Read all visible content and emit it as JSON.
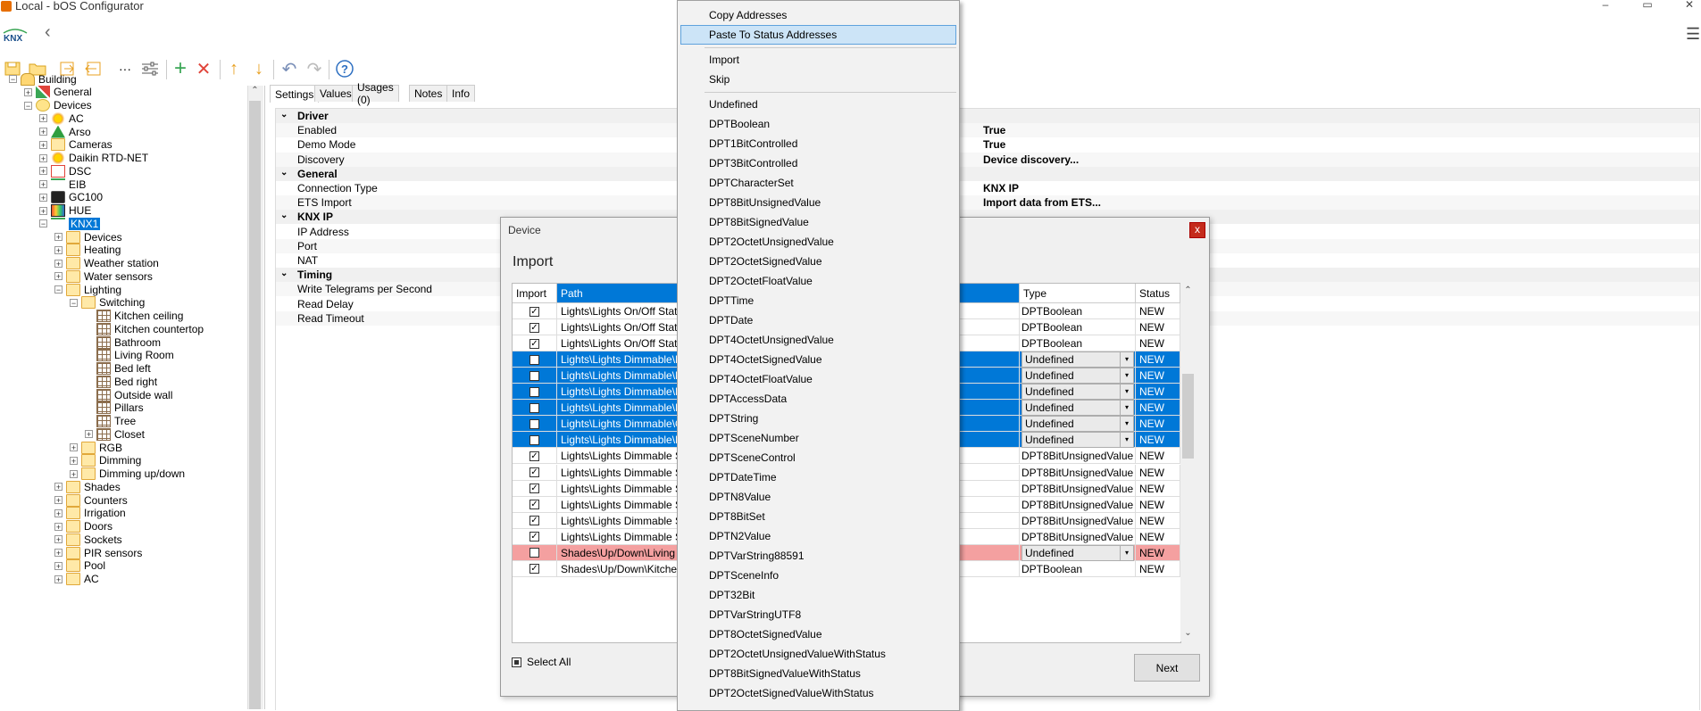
{
  "window": {
    "title": "Local - bOS Configurator",
    "controls": [
      "–",
      "▭",
      "✕"
    ]
  },
  "toolbar": {
    "icons": [
      "save-icon",
      "open-folder-icon",
      "export-icon",
      "import-icon",
      "more-icon",
      "settings-sliders-icon",
      "add-icon",
      "delete-icon",
      "move-up-icon",
      "move-down-icon",
      "undo-icon",
      "redo-icon",
      "help-icon"
    ],
    "more_label": "···"
  },
  "tree": {
    "items": [
      {
        "label": "Building",
        "depth": 0,
        "icon": "building-icon",
        "expander": "−"
      },
      {
        "label": "General",
        "depth": 1,
        "icon": "tools-icon",
        "expander": "+"
      },
      {
        "label": "Devices",
        "depth": 1,
        "icon": "bulb-icon",
        "expander": "−"
      },
      {
        "label": "AC",
        "depth": 2,
        "icon": "sun-icon",
        "expander": "+"
      },
      {
        "label": "Arso",
        "depth": 2,
        "icon": "tree-icon",
        "expander": "+"
      },
      {
        "label": "Cameras",
        "depth": 2,
        "icon": "folder-icon",
        "expander": "+"
      },
      {
        "label": "Daikin RTD-NET",
        "depth": 2,
        "icon": "sun-icon",
        "expander": "+"
      },
      {
        "label": "DSC",
        "depth": 2,
        "icon": "dsc-icon",
        "expander": "+"
      },
      {
        "label": "EIB",
        "depth": 2,
        "icon": "knx-icon",
        "expander": "+"
      },
      {
        "label": "GC100",
        "depth": 2,
        "icon": "gc-icon",
        "expander": "+"
      },
      {
        "label": "HUE",
        "depth": 2,
        "icon": "hue-icon",
        "expander": "+"
      },
      {
        "label": "KNX1",
        "depth": 2,
        "icon": "knx-icon",
        "expander": "−",
        "selected": true
      },
      {
        "label": "Devices",
        "depth": 3,
        "icon": "folder-icon",
        "expander": "+"
      },
      {
        "label": "Heating",
        "depth": 3,
        "icon": "folder-icon",
        "expander": "+"
      },
      {
        "label": "Weather station",
        "depth": 3,
        "icon": "folder-icon",
        "expander": "+"
      },
      {
        "label": "Water sensors",
        "depth": 3,
        "icon": "folder-icon",
        "expander": "+"
      },
      {
        "label": "Lighting",
        "depth": 3,
        "icon": "folder-icon",
        "expander": "−"
      },
      {
        "label": "Switching",
        "depth": 4,
        "icon": "folder-icon",
        "expander": "−"
      },
      {
        "label": "Kitchen ceiling",
        "depth": 5,
        "icon": "grid-icon",
        "expander": ""
      },
      {
        "label": "Kitchen countertop",
        "depth": 5,
        "icon": "grid-icon",
        "expander": ""
      },
      {
        "label": "Bathroom",
        "depth": 5,
        "icon": "grid-icon",
        "expander": ""
      },
      {
        "label": "Living Room",
        "depth": 5,
        "icon": "grid-icon",
        "expander": ""
      },
      {
        "label": "Bed left",
        "depth": 5,
        "icon": "grid-icon",
        "expander": ""
      },
      {
        "label": "Bed right",
        "depth": 5,
        "icon": "grid-icon",
        "expander": ""
      },
      {
        "label": "Outside wall",
        "depth": 5,
        "icon": "grid-icon",
        "expander": ""
      },
      {
        "label": "Pillars",
        "depth": 5,
        "icon": "grid-icon",
        "expander": ""
      },
      {
        "label": "Tree",
        "depth": 5,
        "icon": "grid-icon",
        "expander": ""
      },
      {
        "label": "Closet",
        "depth": 5,
        "icon": "grid-icon",
        "expander": "+"
      },
      {
        "label": "RGB",
        "depth": 4,
        "icon": "folder-icon",
        "expander": "+"
      },
      {
        "label": "Dimming",
        "depth": 4,
        "icon": "folder-icon",
        "expander": "+"
      },
      {
        "label": "Dimming up/down",
        "depth": 4,
        "icon": "folder-icon",
        "expander": "+"
      },
      {
        "label": "Shades",
        "depth": 3,
        "icon": "folder-icon",
        "expander": "+"
      },
      {
        "label": "Counters",
        "depth": 3,
        "icon": "folder-icon",
        "expander": "+"
      },
      {
        "label": "Irrigation",
        "depth": 3,
        "icon": "folder-icon",
        "expander": "+"
      },
      {
        "label": "Doors",
        "depth": 3,
        "icon": "folder-icon",
        "expander": "+"
      },
      {
        "label": "Sockets",
        "depth": 3,
        "icon": "folder-icon",
        "expander": "+"
      },
      {
        "label": "PIR sensors",
        "depth": 3,
        "icon": "folder-icon",
        "expander": "+"
      },
      {
        "label": "Pool",
        "depth": 3,
        "icon": "folder-icon",
        "expander": "+"
      },
      {
        "label": "AC",
        "depth": 3,
        "icon": "folder-icon",
        "expander": "+"
      }
    ]
  },
  "props_tabs": [
    "Settings",
    "Values",
    "Usages (0)",
    "Notes",
    "Info"
  ],
  "props": {
    "rows": [
      {
        "kind": "cat",
        "name": "Driver"
      },
      {
        "kind": "prop",
        "name": "Enabled",
        "value": "True"
      },
      {
        "kind": "prop",
        "name": "Demo Mode",
        "value": "True"
      },
      {
        "kind": "prop",
        "name": "Discovery",
        "value": "Device discovery..."
      },
      {
        "kind": "cat",
        "name": "General"
      },
      {
        "kind": "prop",
        "name": "Connection Type",
        "value": "KNX IP"
      },
      {
        "kind": "prop",
        "name": "ETS Import",
        "value": "Import data from ETS..."
      },
      {
        "kind": "cat",
        "name": "KNX IP"
      },
      {
        "kind": "prop",
        "name": "IP Address",
        "value": ""
      },
      {
        "kind": "prop",
        "name": "Port",
        "value": ""
      },
      {
        "kind": "prop",
        "name": "NAT",
        "value": ""
      },
      {
        "kind": "cat",
        "name": "Timing"
      },
      {
        "kind": "prop",
        "name": "Write Telegrams per Second",
        "value": ""
      },
      {
        "kind": "prop",
        "name": "Read Delay",
        "value": ""
      },
      {
        "kind": "prop",
        "name": "Read Timeout",
        "value": ""
      }
    ]
  },
  "dialog": {
    "title": "Device",
    "close": "x",
    "heading": "Import",
    "columns": [
      "Import",
      "Path",
      "Type",
      "Status"
    ],
    "rows": [
      {
        "checked": true,
        "path": "Lights\\Lights On/Off Status\\",
        "type": "DPTBoolean",
        "status": "NEW",
        "style": "normal",
        "combo": false
      },
      {
        "checked": true,
        "path": "Lights\\Lights On/Off Status\\",
        "type": "DPTBoolean",
        "status": "NEW",
        "style": "normal",
        "combo": false
      },
      {
        "checked": true,
        "path": "Lights\\Lights On/Off Status\\",
        "type": "DPTBoolean",
        "status": "NEW",
        "style": "normal",
        "combo": false
      },
      {
        "checked": false,
        "path": "Lights\\Lights Dimmable\\Bed",
        "type": "Undefined",
        "status": "NEW",
        "style": "sel",
        "combo": true
      },
      {
        "checked": false,
        "path": "Lights\\Lights Dimmable\\Livi",
        "type": "Undefined",
        "status": "NEW",
        "style": "sel",
        "combo": true
      },
      {
        "checked": false,
        "path": "Lights\\Lights Dimmable\\Kitc",
        "type": "Undefined",
        "status": "NEW",
        "style": "sel",
        "combo": true
      },
      {
        "checked": false,
        "path": "Lights\\Lights Dimmable\\Dec",
        "type": "Undefined",
        "status": "NEW",
        "style": "sel",
        "combo": true
      },
      {
        "checked": false,
        "path": "Lights\\Lights Dimmable\\Out",
        "type": "Undefined",
        "status": "NEW",
        "style": "sel",
        "combo": true
      },
      {
        "checked": false,
        "path": "Lights\\Lights Dimmable\\Hall",
        "type": "Undefined",
        "status": "NEW",
        "style": "sel",
        "combo": true
      },
      {
        "checked": true,
        "path": "Lights\\Lights Dimmable Stat",
        "type": "DPT8BitUnsignedValue",
        "status": "NEW",
        "style": "normal",
        "combo": false
      },
      {
        "checked": true,
        "path": "Lights\\Lights Dimmable Stat",
        "type": "DPT8BitUnsignedValue",
        "status": "NEW",
        "style": "normal",
        "combo": false
      },
      {
        "checked": true,
        "path": "Lights\\Lights Dimmable Stat",
        "type": "DPT8BitUnsignedValue",
        "status": "NEW",
        "style": "normal",
        "combo": false
      },
      {
        "checked": true,
        "path": "Lights\\Lights Dimmable Stat",
        "type": "DPT8BitUnsignedValue",
        "status": "NEW",
        "style": "normal",
        "combo": false
      },
      {
        "checked": true,
        "path": "Lights\\Lights Dimmable Stat",
        "type": "DPT8BitUnsignedValue",
        "status": "NEW",
        "style": "normal",
        "combo": false
      },
      {
        "checked": true,
        "path": "Lights\\Lights Dimmable Stat",
        "type": "DPT8BitUnsignedValue",
        "status": "NEW",
        "style": "normal",
        "combo": false
      },
      {
        "checked": false,
        "path": "Shades\\Up/Down\\Living Ro",
        "type": "Undefined",
        "status": "NEW",
        "style": "err",
        "combo": true
      },
      {
        "checked": true,
        "path": "Shades\\Up/Down\\Kitchen",
        "type": "DPTBoolean",
        "status": "NEW",
        "style": "normal",
        "combo": false
      }
    ],
    "select_all_label": "Select All",
    "next_label": "Next"
  },
  "context_menu": {
    "items": [
      {
        "label": "Copy Addresses"
      },
      {
        "label": "Paste To Status Addresses",
        "highlighted": true
      },
      {
        "sep": true
      },
      {
        "label": "Import"
      },
      {
        "label": "Skip"
      },
      {
        "sep": true
      },
      {
        "label": "Undefined"
      },
      {
        "label": "DPTBoolean"
      },
      {
        "label": "DPT1BitControlled"
      },
      {
        "label": "DPT3BitControlled"
      },
      {
        "label": "DPTCharacterSet"
      },
      {
        "label": "DPT8BitUnsignedValue"
      },
      {
        "label": "DPT8BitSignedValue"
      },
      {
        "label": "DPT2OctetUnsignedValue"
      },
      {
        "label": "DPT2OctetSignedValue"
      },
      {
        "label": "DPT2OctetFloatValue"
      },
      {
        "label": "DPTTime"
      },
      {
        "label": "DPTDate"
      },
      {
        "label": "DPT4OctetUnsignedValue"
      },
      {
        "label": "DPT4OctetSignedValue"
      },
      {
        "label": "DPT4OctetFloatValue"
      },
      {
        "label": "DPTAccessData"
      },
      {
        "label": "DPTString"
      },
      {
        "label": "DPTSceneNumber"
      },
      {
        "label": "DPTSceneControl"
      },
      {
        "label": "DPTDateTime"
      },
      {
        "label": "DPTN8Value"
      },
      {
        "label": "DPT8BitSet"
      },
      {
        "label": "DPTN2Value"
      },
      {
        "label": "DPTVarString88591"
      },
      {
        "label": "DPTSceneInfo"
      },
      {
        "label": "DPT32Bit"
      },
      {
        "label": "DPTVarStringUTF8"
      },
      {
        "label": "DPT8OctetSignedValue"
      },
      {
        "label": "DPT2OctetUnsignedValueWithStatus"
      },
      {
        "label": "DPT8BitSignedValueWithStatus"
      },
      {
        "label": "DPT2OctetSignedValueWithStatus"
      }
    ]
  },
  "colors": {
    "accent": "#0078d7",
    "error_row": "#f4a0a0",
    "menu_highlight": "#cce4f7"
  }
}
